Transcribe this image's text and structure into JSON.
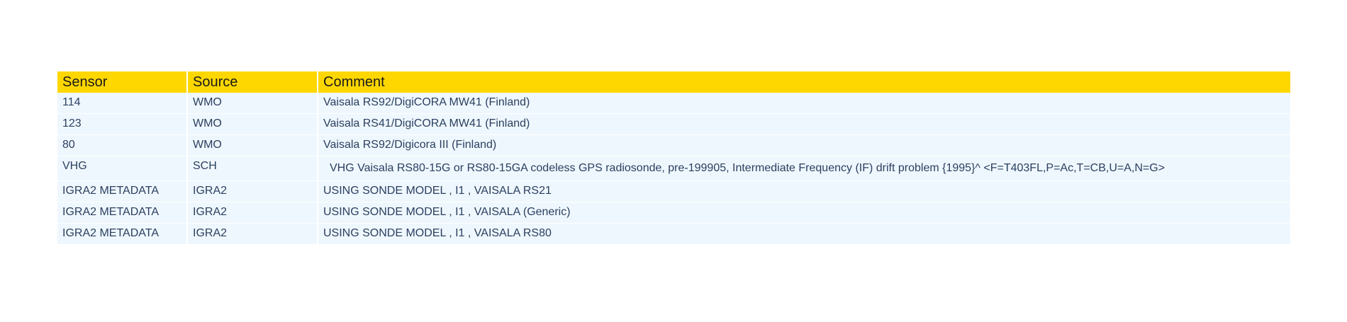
{
  "table": {
    "headers": [
      "Sensor",
      "Source",
      "Comment"
    ],
    "rows": [
      {
        "sensor": "114",
        "source": "WMO",
        "comment": "Vaisala RS92/DigiCORA MW41 (Finland)"
      },
      {
        "sensor": "123",
        "source": "WMO",
        "comment": "Vaisala RS41/DigiCORA MW41 (Finland)"
      },
      {
        "sensor": "80",
        "source": "WMO",
        "comment": "Vaisala RS92/Digicora III (Finland)"
      },
      {
        "sensor": "VHG",
        "source": "SCH",
        "comment": "VHG Vaisala RS80-15G or RS80-15GA codeless GPS radiosonde, pre-199905, Intermediate Frequency (IF) drift problem {1995}^ <F=T403FL,P=Ac,T=CB,U=A,N=G>"
      },
      {
        "sensor": "IGRA2 METADATA",
        "source": "IGRA2",
        "comment": "USING SONDE MODEL , I1 , VAISALA RS21"
      },
      {
        "sensor": "IGRA2 METADATA",
        "source": "IGRA2",
        "comment": "USING SONDE MODEL , I1 , VAISALA (Generic)"
      },
      {
        "sensor": "IGRA2 METADATA",
        "source": "IGRA2",
        "comment": "USING SONDE MODEL , I1 , VAISALA RS80"
      }
    ]
  },
  "colors": {
    "header_bg": "#ffd700",
    "cell_bg": "#eff7fe",
    "cell_text": "#2a3f5f"
  }
}
